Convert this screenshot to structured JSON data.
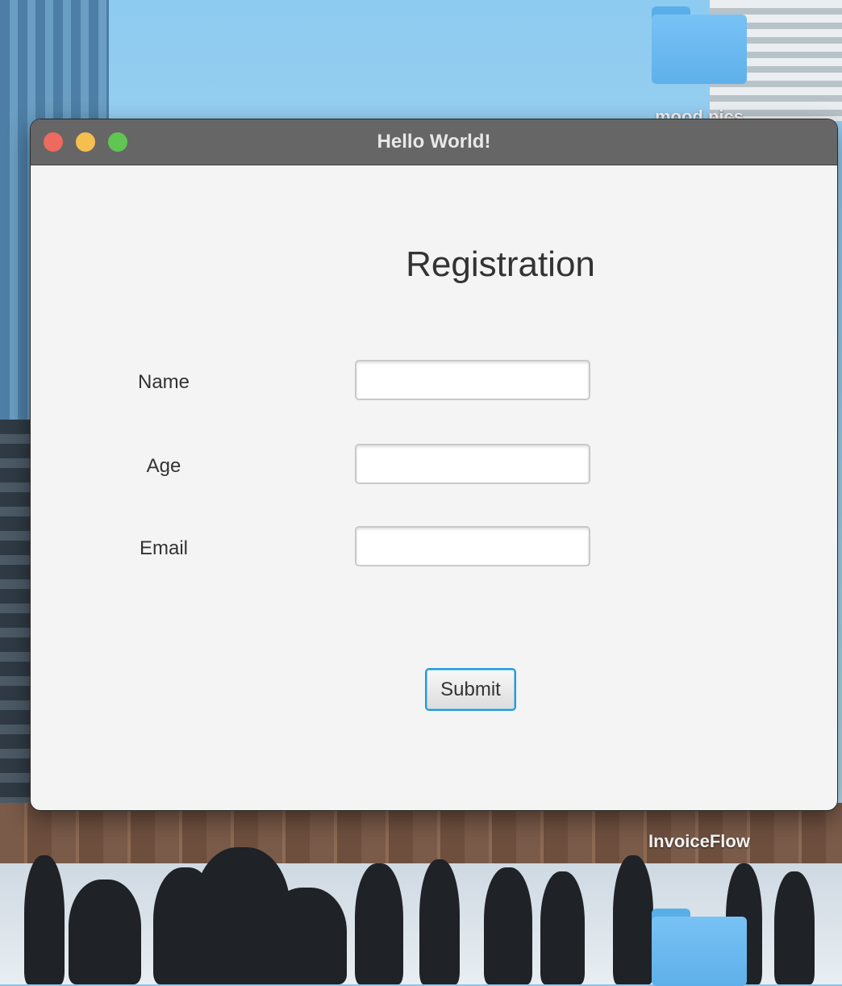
{
  "window": {
    "title": "Hello World!"
  },
  "form": {
    "heading": "Registration",
    "fields": [
      {
        "label": "Name",
        "value": ""
      },
      {
        "label": "Age",
        "value": ""
      },
      {
        "label": "Email",
        "value": ""
      }
    ],
    "submit_label": "Submit"
  },
  "desktop": {
    "icons": [
      {
        "name": "folder-icon",
        "label": "mood pics"
      },
      {
        "name": "folder-icon",
        "label": "InvoiceFlow"
      }
    ]
  },
  "colors": {
    "accent": "#1f9bd8",
    "titlebar": "#666666",
    "close": "#ed6a5e",
    "minimize": "#f5bf4f",
    "maximize": "#61c554"
  }
}
